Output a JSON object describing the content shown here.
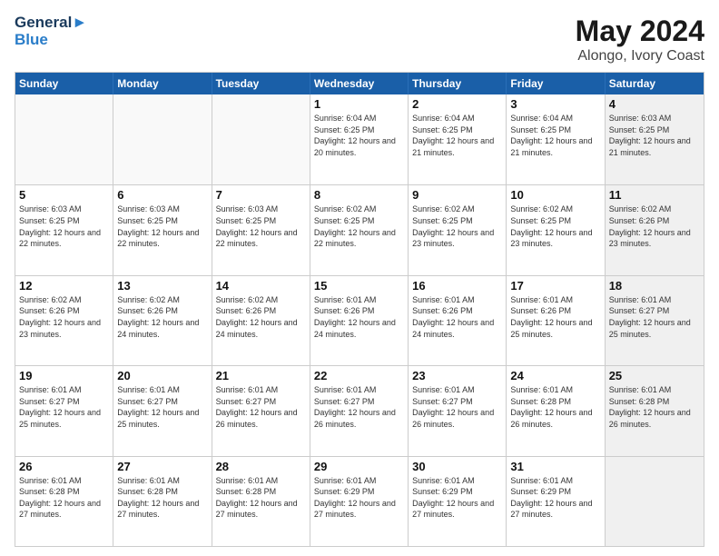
{
  "logo": {
    "line1": "General",
    "line2": "Blue"
  },
  "title": "May 2024",
  "subtitle": "Alongo, Ivory Coast",
  "header_days": [
    "Sunday",
    "Monday",
    "Tuesday",
    "Wednesday",
    "Thursday",
    "Friday",
    "Saturday"
  ],
  "weeks": [
    [
      {
        "day": "",
        "info": "",
        "empty": true
      },
      {
        "day": "",
        "info": "",
        "empty": true
      },
      {
        "day": "",
        "info": "",
        "empty": true
      },
      {
        "day": "1",
        "info": "Sunrise: 6:04 AM\nSunset: 6:25 PM\nDaylight: 12 hours\nand 20 minutes."
      },
      {
        "day": "2",
        "info": "Sunrise: 6:04 AM\nSunset: 6:25 PM\nDaylight: 12 hours\nand 21 minutes."
      },
      {
        "day": "3",
        "info": "Sunrise: 6:04 AM\nSunset: 6:25 PM\nDaylight: 12 hours\nand 21 minutes."
      },
      {
        "day": "4",
        "info": "Sunrise: 6:03 AM\nSunset: 6:25 PM\nDaylight: 12 hours\nand 21 minutes.",
        "shaded": true
      }
    ],
    [
      {
        "day": "5",
        "info": "Sunrise: 6:03 AM\nSunset: 6:25 PM\nDaylight: 12 hours\nand 22 minutes."
      },
      {
        "day": "6",
        "info": "Sunrise: 6:03 AM\nSunset: 6:25 PM\nDaylight: 12 hours\nand 22 minutes."
      },
      {
        "day": "7",
        "info": "Sunrise: 6:03 AM\nSunset: 6:25 PM\nDaylight: 12 hours\nand 22 minutes."
      },
      {
        "day": "8",
        "info": "Sunrise: 6:02 AM\nSunset: 6:25 PM\nDaylight: 12 hours\nand 22 minutes."
      },
      {
        "day": "9",
        "info": "Sunrise: 6:02 AM\nSunset: 6:25 PM\nDaylight: 12 hours\nand 23 minutes."
      },
      {
        "day": "10",
        "info": "Sunrise: 6:02 AM\nSunset: 6:25 PM\nDaylight: 12 hours\nand 23 minutes."
      },
      {
        "day": "11",
        "info": "Sunrise: 6:02 AM\nSunset: 6:26 PM\nDaylight: 12 hours\nand 23 minutes.",
        "shaded": true
      }
    ],
    [
      {
        "day": "12",
        "info": "Sunrise: 6:02 AM\nSunset: 6:26 PM\nDaylight: 12 hours\nand 23 minutes."
      },
      {
        "day": "13",
        "info": "Sunrise: 6:02 AM\nSunset: 6:26 PM\nDaylight: 12 hours\nand 24 minutes."
      },
      {
        "day": "14",
        "info": "Sunrise: 6:02 AM\nSunset: 6:26 PM\nDaylight: 12 hours\nand 24 minutes."
      },
      {
        "day": "15",
        "info": "Sunrise: 6:01 AM\nSunset: 6:26 PM\nDaylight: 12 hours\nand 24 minutes."
      },
      {
        "day": "16",
        "info": "Sunrise: 6:01 AM\nSunset: 6:26 PM\nDaylight: 12 hours\nand 24 minutes."
      },
      {
        "day": "17",
        "info": "Sunrise: 6:01 AM\nSunset: 6:26 PM\nDaylight: 12 hours\nand 25 minutes."
      },
      {
        "day": "18",
        "info": "Sunrise: 6:01 AM\nSunset: 6:27 PM\nDaylight: 12 hours\nand 25 minutes.",
        "shaded": true
      }
    ],
    [
      {
        "day": "19",
        "info": "Sunrise: 6:01 AM\nSunset: 6:27 PM\nDaylight: 12 hours\nand 25 minutes."
      },
      {
        "day": "20",
        "info": "Sunrise: 6:01 AM\nSunset: 6:27 PM\nDaylight: 12 hours\nand 25 minutes."
      },
      {
        "day": "21",
        "info": "Sunrise: 6:01 AM\nSunset: 6:27 PM\nDaylight: 12 hours\nand 26 minutes."
      },
      {
        "day": "22",
        "info": "Sunrise: 6:01 AM\nSunset: 6:27 PM\nDaylight: 12 hours\nand 26 minutes."
      },
      {
        "day": "23",
        "info": "Sunrise: 6:01 AM\nSunset: 6:27 PM\nDaylight: 12 hours\nand 26 minutes."
      },
      {
        "day": "24",
        "info": "Sunrise: 6:01 AM\nSunset: 6:28 PM\nDaylight: 12 hours\nand 26 minutes."
      },
      {
        "day": "25",
        "info": "Sunrise: 6:01 AM\nSunset: 6:28 PM\nDaylight: 12 hours\nand 26 minutes.",
        "shaded": true
      }
    ],
    [
      {
        "day": "26",
        "info": "Sunrise: 6:01 AM\nSunset: 6:28 PM\nDaylight: 12 hours\nand 27 minutes."
      },
      {
        "day": "27",
        "info": "Sunrise: 6:01 AM\nSunset: 6:28 PM\nDaylight: 12 hours\nand 27 minutes."
      },
      {
        "day": "28",
        "info": "Sunrise: 6:01 AM\nSunset: 6:28 PM\nDaylight: 12 hours\nand 27 minutes."
      },
      {
        "day": "29",
        "info": "Sunrise: 6:01 AM\nSunset: 6:29 PM\nDaylight: 12 hours\nand 27 minutes."
      },
      {
        "day": "30",
        "info": "Sunrise: 6:01 AM\nSunset: 6:29 PM\nDaylight: 12 hours\nand 27 minutes."
      },
      {
        "day": "31",
        "info": "Sunrise: 6:01 AM\nSunset: 6:29 PM\nDaylight: 12 hours\nand 27 minutes."
      },
      {
        "day": "",
        "info": "",
        "empty": true,
        "shaded": true
      }
    ]
  ]
}
